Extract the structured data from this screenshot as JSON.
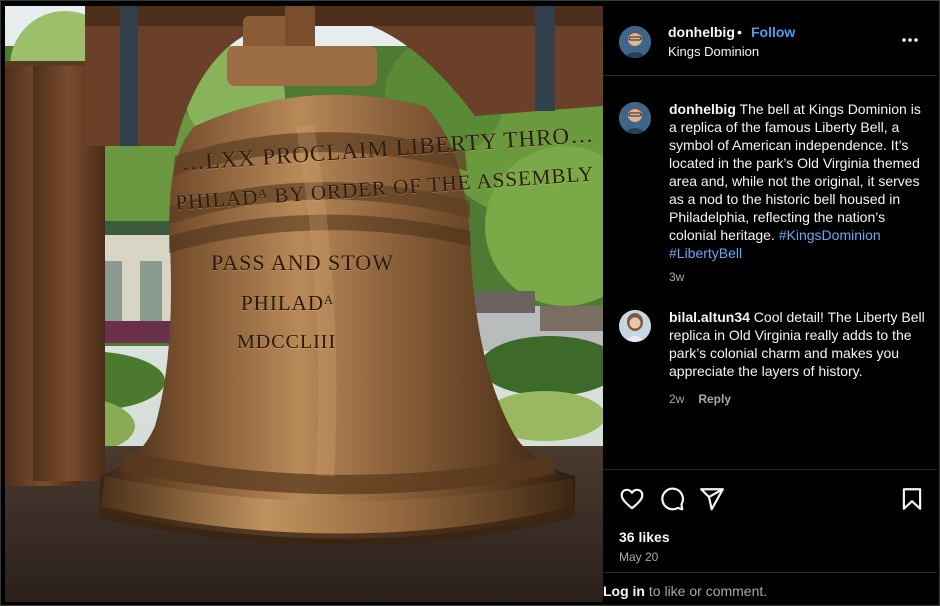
{
  "post": {
    "username": "donhelbig",
    "separator": "•",
    "follow_label": "Follow",
    "location": "Kings Dominion",
    "image_alt": "Bronze Liberty Bell replica hanging from a wooden frame among trees",
    "bell_engravings": {
      "line1": "…LXX PROCLAIM LIBERTY THRO…",
      "line2": "PHILADᴬ BY ORDER OF THE ASSEMBLY",
      "line3": "PASS AND STOW",
      "line4": "PHILADᴬ",
      "line5": "MDCCLIII"
    }
  },
  "caption": {
    "username": "donhelbig",
    "text": " The bell at Kings Dominion is a replica of the famous Liberty Bell, a symbol of American independence. It’s located in the park’s Old Virginia themed area and, while not the original, it serves as a nod to the historic bell housed in Philadelphia, reflecting the nation’s colonial heritage. ",
    "hashtag1": "#KingsDominion",
    "hashtag2": "#LibertyBell",
    "age": "3w"
  },
  "comments": [
    {
      "username": "bilal.altun34",
      "text": " Cool detail! The Liberty Bell replica in Old Virginia really adds to the park’s colonial charm and makes you appreciate the layers of history.",
      "age": "2w",
      "reply_label": "Reply"
    }
  ],
  "actions": {
    "likes": "36 likes",
    "date": "May 20",
    "icons": [
      "heart-icon",
      "comment-icon",
      "share-icon",
      "bookmark-icon"
    ]
  },
  "login": {
    "link_label": "Log in",
    "suffix": " to like or comment."
  },
  "colors": {
    "background": "#000000",
    "link_blue": "#4a9bf7",
    "hashtag_blue": "#6aa7f7",
    "muted": "#a8a8a8"
  }
}
